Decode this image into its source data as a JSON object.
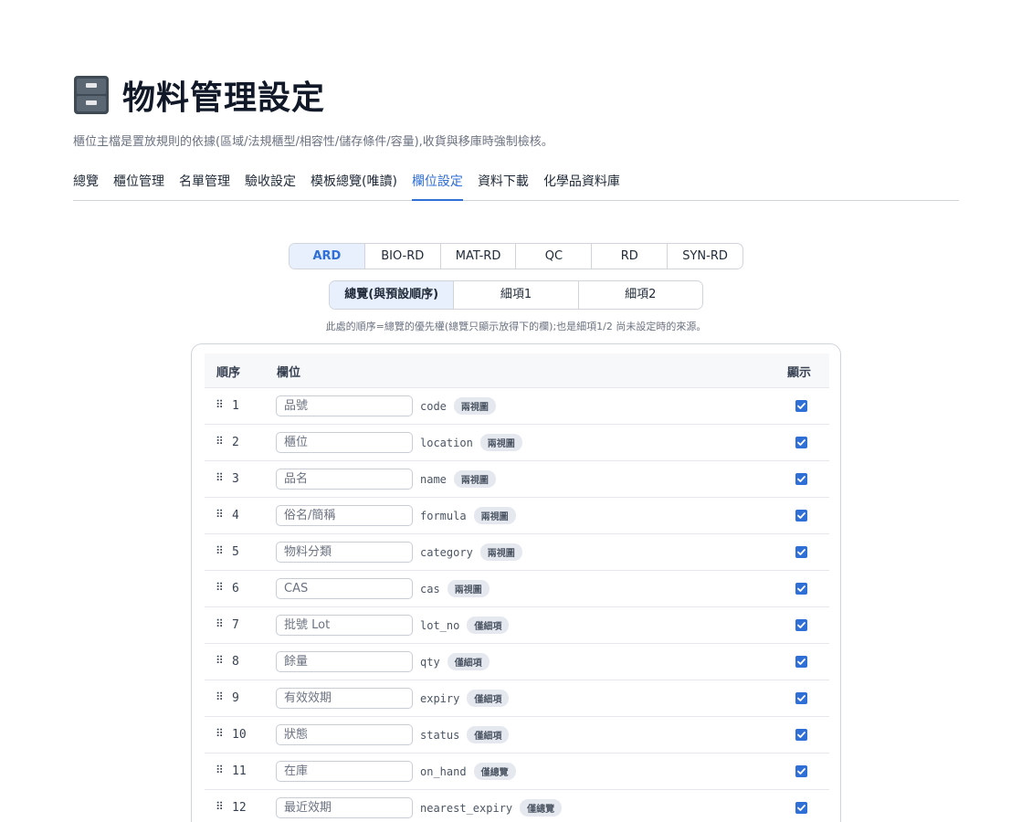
{
  "header": {
    "title": "物料管理設定",
    "subtitle": "櫃位主檔是置放規則的依據(區域/法規櫃型/相容性/儲存條件/容量),收貨與移庫時強制檢核。"
  },
  "tabs": [
    {
      "label": "總覽"
    },
    {
      "label": "櫃位管理"
    },
    {
      "label": "名單管理"
    },
    {
      "label": "驗收設定"
    },
    {
      "label": "模板總覽(唯讀)"
    },
    {
      "label": "欄位設定",
      "active": true
    },
    {
      "label": "資料下載"
    },
    {
      "label": "化學品資料庫"
    }
  ],
  "departments": [
    {
      "label": "ARD",
      "active": true
    },
    {
      "label": "BIO-RD"
    },
    {
      "label": "MAT-RD"
    },
    {
      "label": "QC"
    },
    {
      "label": "RD"
    },
    {
      "label": "SYN-RD"
    }
  ],
  "views": [
    {
      "label": "總覽(與預設順序)",
      "active": true
    },
    {
      "label": "細項1"
    },
    {
      "label": "細項2"
    }
  ],
  "hint": "此處的順序=總覽的優先權(總覽只顯示放得下的欄);也是細項1/2 尚未設定時的來源。",
  "table": {
    "headers": {
      "order": "順序",
      "field": "欄位",
      "show": "顯示"
    },
    "rows": [
      {
        "order": "1",
        "placeholder": "品號",
        "key": "code",
        "badge": "兩視圖",
        "visible": true
      },
      {
        "order": "2",
        "placeholder": "櫃位",
        "key": "location",
        "badge": "兩視圖",
        "visible": true
      },
      {
        "order": "3",
        "placeholder": "品名",
        "key": "name",
        "badge": "兩視圖",
        "visible": true
      },
      {
        "order": "4",
        "placeholder": "俗名/簡稱",
        "key": "formula",
        "badge": "兩視圖",
        "visible": true
      },
      {
        "order": "5",
        "placeholder": "物料分類",
        "key": "category",
        "badge": "兩視圖",
        "visible": true
      },
      {
        "order": "6",
        "placeholder": "CAS",
        "key": "cas",
        "badge": "兩視圖",
        "visible": true
      },
      {
        "order": "7",
        "placeholder": "批號 Lot",
        "key": "lot_no",
        "badge": "僅細項",
        "visible": true
      },
      {
        "order": "8",
        "placeholder": "餘量",
        "key": "qty",
        "badge": "僅細項",
        "visible": true
      },
      {
        "order": "9",
        "placeholder": "有效效期",
        "key": "expiry",
        "badge": "僅細項",
        "visible": true
      },
      {
        "order": "10",
        "placeholder": "狀態",
        "key": "status",
        "badge": "僅細項",
        "visible": true
      },
      {
        "order": "11",
        "placeholder": "在庫",
        "key": "on_hand",
        "badge": "僅總覽",
        "visible": true
      },
      {
        "order": "12",
        "placeholder": "最近效期",
        "key": "nearest_expiry",
        "badge": "僅總覽",
        "visible": true
      }
    ]
  },
  "colors": {
    "accent": "#2f6fd6",
    "accent_bg": "#e7f0fc",
    "badge_bg": "#e5e9ef"
  },
  "icons": {
    "title": "file-cabinet-icon",
    "drag": "drag-handle-icon",
    "check": "checkbox-checked-icon"
  }
}
